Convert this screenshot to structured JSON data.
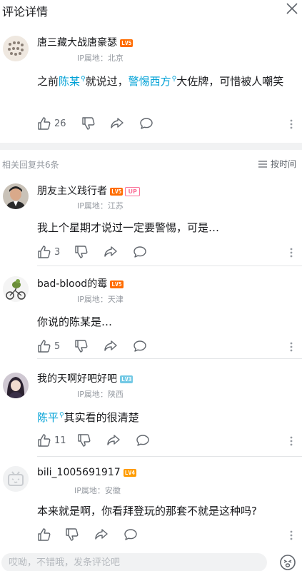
{
  "header": {
    "title": "评论详情"
  },
  "main_comment": {
    "user": "唐三藏大战唐豪瑟",
    "level": "LV5",
    "ip": "IP属地：北京",
    "text_prefix": "之前",
    "link1": "陈某",
    "text_mid": "就说过，",
    "link2": "警惕西方",
    "text_suffix": "大佐牌，可惜被人嘲笑",
    "likes": "26"
  },
  "replies_header": {
    "count_label": "相关回复共6条",
    "sort_label": "按时间"
  },
  "replies": [
    {
      "user": "朋友主义践行者",
      "level": "LV5",
      "up": "UP",
      "ip": "IP属地：江苏",
      "text": "我上个星期才说过一定要警惕，可是…",
      "likes": "3"
    },
    {
      "user": "bad-blood的霉",
      "level": "LV5",
      "ip": "IP属地：天津",
      "text": "你说的陈某是…",
      "likes": "5"
    },
    {
      "user": "我的天啊好吧好吧",
      "level": "LV3",
      "ip": "IP属地：陕西",
      "link": "陈平",
      "text": "其实看的很清楚",
      "likes": "11"
    },
    {
      "user": "bili_1005691917",
      "level": "LV4",
      "ip": "IP属地：安徽",
      "text": "本来就是啊，你看拜登玩的那套不就是这种吗?",
      "likes": ""
    }
  ],
  "bottom_bar": {
    "placeholder": "哎呦，不错哦，发条评论吧"
  },
  "colors": {
    "lv5": "#ff6c00",
    "lv4": "#ff9c00",
    "lv3": "#73c9e5",
    "link": "#00a1d6",
    "up": "#fb7299"
  }
}
